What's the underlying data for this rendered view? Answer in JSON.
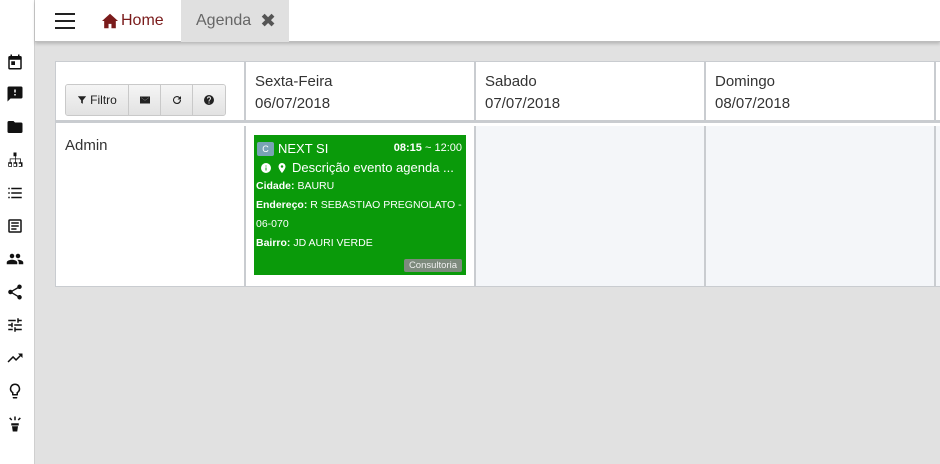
{
  "tabs": {
    "home_label": "Home",
    "agenda_label": "Agenda",
    "close_glyph": "✖"
  },
  "sidebar_icons": [
    "calendar-icon",
    "feedback-icon",
    "folder-icon",
    "sitemap-icon",
    "list-icon",
    "report-icon",
    "people-icon",
    "share-icon",
    "tune-icon",
    "trending-icon",
    "lightbulb-icon",
    "lamp-icon"
  ],
  "toolbar": {
    "filter_label": "Filtro"
  },
  "days": [
    {
      "name": "Sexta-Feira",
      "date": "06/07/2018"
    },
    {
      "name": "Sabado",
      "date": "07/07/2018"
    },
    {
      "name": "Domingo",
      "date": "08/07/2018"
    }
  ],
  "rows": [
    {
      "label": "Admin"
    }
  ],
  "event": {
    "badge": "C",
    "title": "NEXT SI",
    "time_start": "08:15",
    "time_sep": "~",
    "time_end": "12:00",
    "description": "Descrição evento agenda ...",
    "city_label": "Cidade:",
    "city": "BAURU",
    "address_label": "Endereço:",
    "address_line1": "R SEBASTIAO PREGNOLATO -",
    "address_line2": "06-070",
    "district_label": "Bairro:",
    "district": "JD AURI VERDE",
    "tag": "Consultoria",
    "color": "#0a9a0a"
  },
  "colors": {
    "accent": "#7a1b1b",
    "event_green": "#0a9a0a"
  }
}
